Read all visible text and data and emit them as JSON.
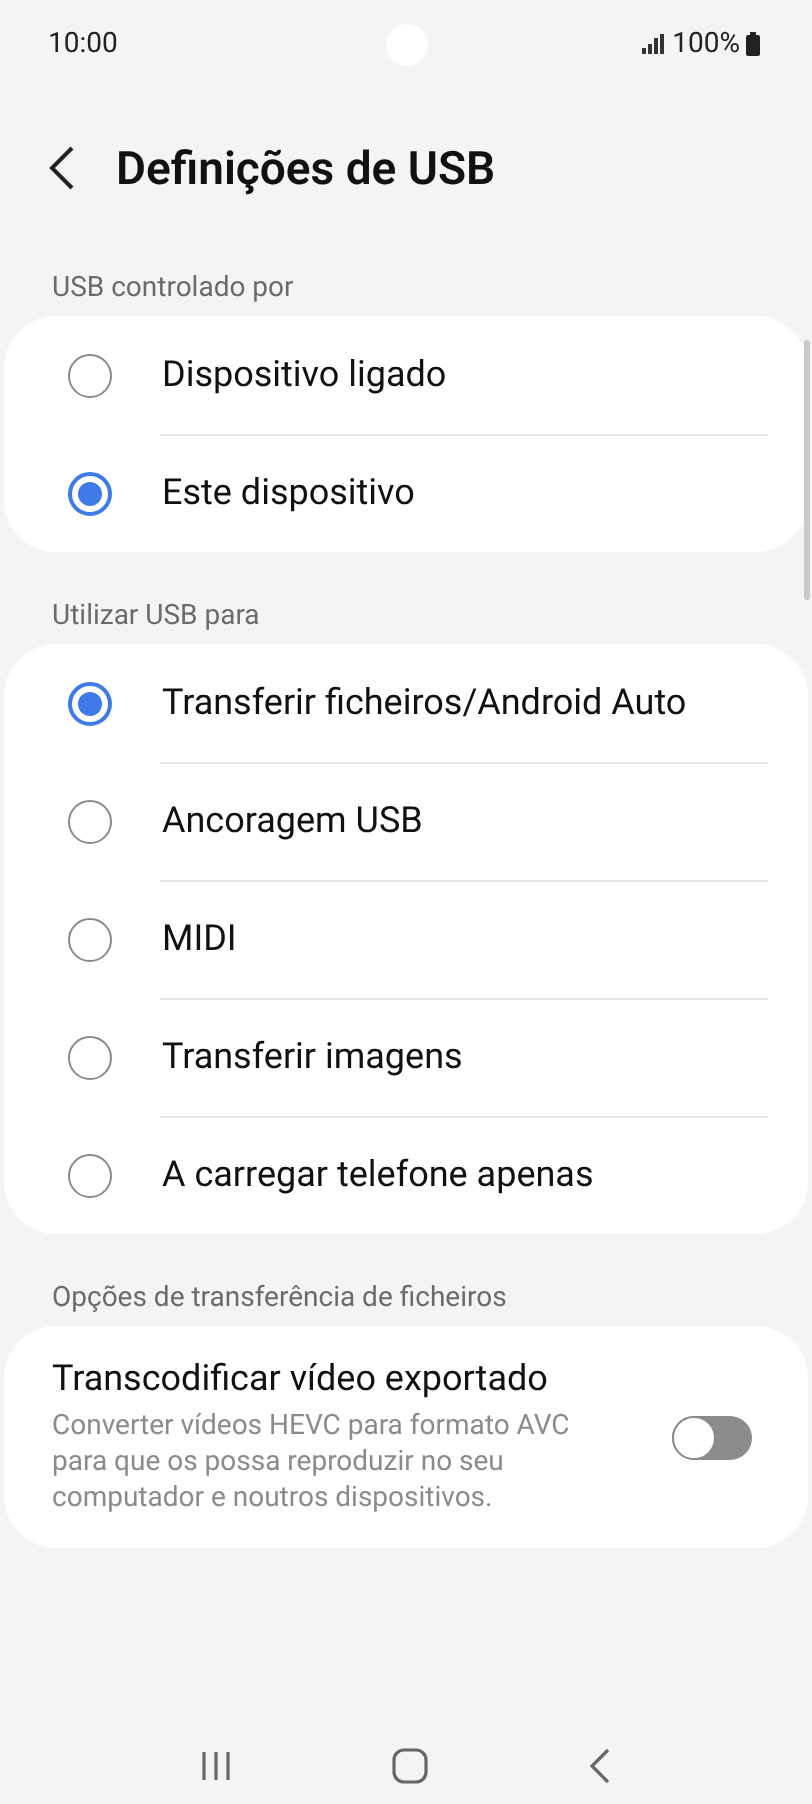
{
  "status_bar": {
    "time": "10:00",
    "battery": "100%"
  },
  "header": {
    "title": "Definições de USB"
  },
  "sections": [
    {
      "title": "USB controlado por",
      "options": [
        {
          "label": "Dispositivo ligado",
          "selected": false
        },
        {
          "label": "Este dispositivo",
          "selected": true
        }
      ]
    },
    {
      "title": "Utilizar USB para",
      "options": [
        {
          "label": "Transferir ficheiros/Android Auto",
          "selected": true
        },
        {
          "label": "Ancoragem USB",
          "selected": false
        },
        {
          "label": "MIDI",
          "selected": false
        },
        {
          "label": "Transferir imagens",
          "selected": false
        },
        {
          "label": "A carregar telefone apenas",
          "selected": false
        }
      ]
    },
    {
      "title": "Opções de transferência de ficheiros",
      "switches": [
        {
          "title": "Transcodificar vídeo exportado",
          "description": "Converter vídeos HEVC para formato AVC para que os possa reproduzir no seu computador e noutros dispositivos.",
          "on": false
        }
      ]
    }
  ]
}
